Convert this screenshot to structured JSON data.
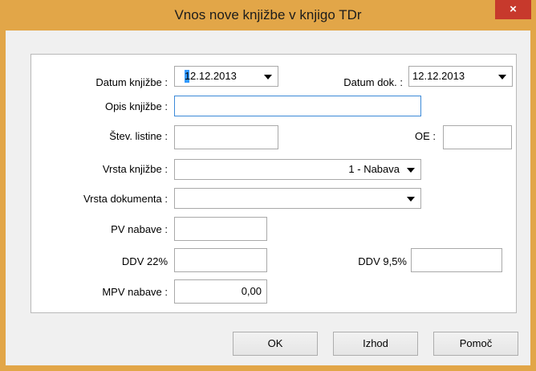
{
  "window": {
    "title": "Vnos nove knjižbe v knjigo TDr",
    "close_glyph": "×"
  },
  "form": {
    "datum_knjizbe": {
      "label": "Datum knjižbe :",
      "value_first": "1",
      "value_rest": "2.12.2013"
    },
    "datum_dok": {
      "label": "Datum dok. :",
      "value": "12.12.2013"
    },
    "opis_knjizbe": {
      "label": "Opis knjižbe :",
      "value": ""
    },
    "stev_listine": {
      "label": "Štev. listine :",
      "value": ""
    },
    "oe": {
      "label": "OE :",
      "value": ""
    },
    "vrsta_knjizbe": {
      "label": "Vrsta knjižbe :",
      "value": "1 - Nabava"
    },
    "vrsta_dokumenta": {
      "label": "Vrsta dokumenta :",
      "value": ""
    },
    "pv_nabave": {
      "label": "PV nabave :",
      "value": ""
    },
    "ddv22": {
      "label": "DDV 22%",
      "value": ""
    },
    "ddv95": {
      "label": "DDV 9,5%",
      "value": ""
    },
    "mpv_nabave": {
      "label": "MPV nabave :",
      "value": "0,00"
    }
  },
  "buttons": {
    "ok": "OK",
    "izhod": "Izhod",
    "pomoc": "Pomoč"
  }
}
